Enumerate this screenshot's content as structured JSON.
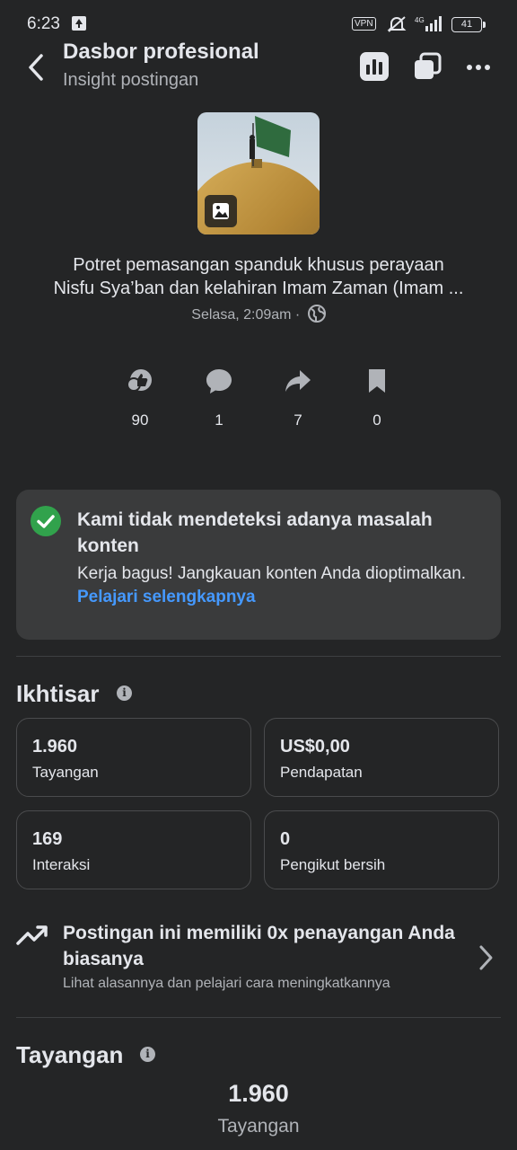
{
  "status_bar": {
    "time": "6:23",
    "vpn": "VPN",
    "network": "4G",
    "battery": "41"
  },
  "header": {
    "title": "Dasbor profesional",
    "subtitle": "Insight postingan"
  },
  "post": {
    "title_line1": "Potret pemasangan spanduk khusus perayaan",
    "title_line2": "Nisfu Sya’ban dan kelahiran Imam Zaman (Imam ...",
    "meta": "Selasa, 2:09am ·"
  },
  "stats": [
    {
      "icon": "reaction-icon",
      "value": "90"
    },
    {
      "icon": "comment-icon",
      "value": "1"
    },
    {
      "icon": "share-icon",
      "value": "7"
    },
    {
      "icon": "save-icon",
      "value": "0"
    }
  ],
  "notice": {
    "title": "Kami tidak mendeteksi adanya masalah konten",
    "body": "Kerja bagus! Jangkauan konten Anda dioptimalkan.",
    "link": "Pelajari selengkapnya"
  },
  "overview": {
    "heading": "Ikhtisar",
    "metrics": [
      {
        "value": "1.960",
        "label": "Tayangan"
      },
      {
        "value": "US$0,00",
        "label": "Pendapatan"
      },
      {
        "value": "169",
        "label": "Interaksi"
      },
      {
        "value": "0",
        "label": "Pengikut bersih"
      }
    ]
  },
  "trend": {
    "title": "Postingan ini memiliki 0x penayangan Anda biasanya",
    "subtitle": "Lihat alasannya dan pelajari cara meningkatkannya"
  },
  "views": {
    "heading": "Tayangan",
    "value": "1.960",
    "label": "Tayangan"
  },
  "colors": {
    "background": "#242526",
    "card": "#3a3b3c",
    "accent": "#4599ff",
    "success": "#31a24c"
  }
}
